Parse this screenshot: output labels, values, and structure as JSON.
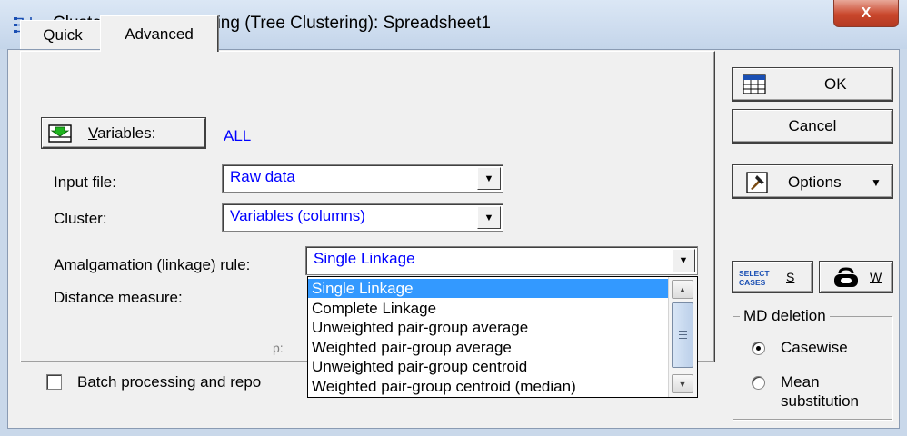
{
  "window": {
    "title": "Cluster Analysis: Joining (Tree Clustering): Spreadsheet1",
    "close_glyph": "X"
  },
  "tabs": [
    {
      "label": "Quick",
      "active": false
    },
    {
      "label": "Advanced",
      "active": true
    }
  ],
  "variables": {
    "button_label": "Variables:",
    "value": "ALL"
  },
  "input_file": {
    "label": "Input file:",
    "value": "Raw data"
  },
  "cluster": {
    "label": "Cluster:",
    "value": "Variables (columns)"
  },
  "amalgamation": {
    "label": "Amalgamation (linkage) rule:",
    "value": "Single Linkage",
    "options": [
      "Single Linkage",
      "Complete Linkage",
      "Unweighted pair-group average",
      "Weighted pair-group average",
      "Unweighted pair-group centroid",
      "Weighted pair-group centroid (median)"
    ],
    "selected_index": 0
  },
  "distance": {
    "label": "Distance measure:",
    "param_label": "p:"
  },
  "batch": {
    "label": "Batch processing and repo",
    "checked": false
  },
  "buttons": {
    "ok": "OK",
    "cancel": "Cancel",
    "options": "Options",
    "select_cases_icon_text": "SELECT CASES",
    "select_cases_key": "S",
    "weight_key": "W"
  },
  "md_deletion": {
    "title": "MD deletion",
    "options": [
      {
        "label": "Casewise",
        "checked": true
      },
      {
        "label": "Mean substitution",
        "checked": false
      }
    ],
    "mean_line1": "Mean",
    "mean_line2": "substitution"
  },
  "colors": {
    "accent_value": "#0000ff",
    "selection": "#3399ff",
    "titlebar": "#c9d8ea",
    "close": "#c9472c"
  },
  "icons": {
    "app": "tree-clustering-icon",
    "variables": "green-arrow-icon",
    "ok": "spreadsheet-icon",
    "options": "options-tools-icon",
    "weight": "weight-icon"
  }
}
